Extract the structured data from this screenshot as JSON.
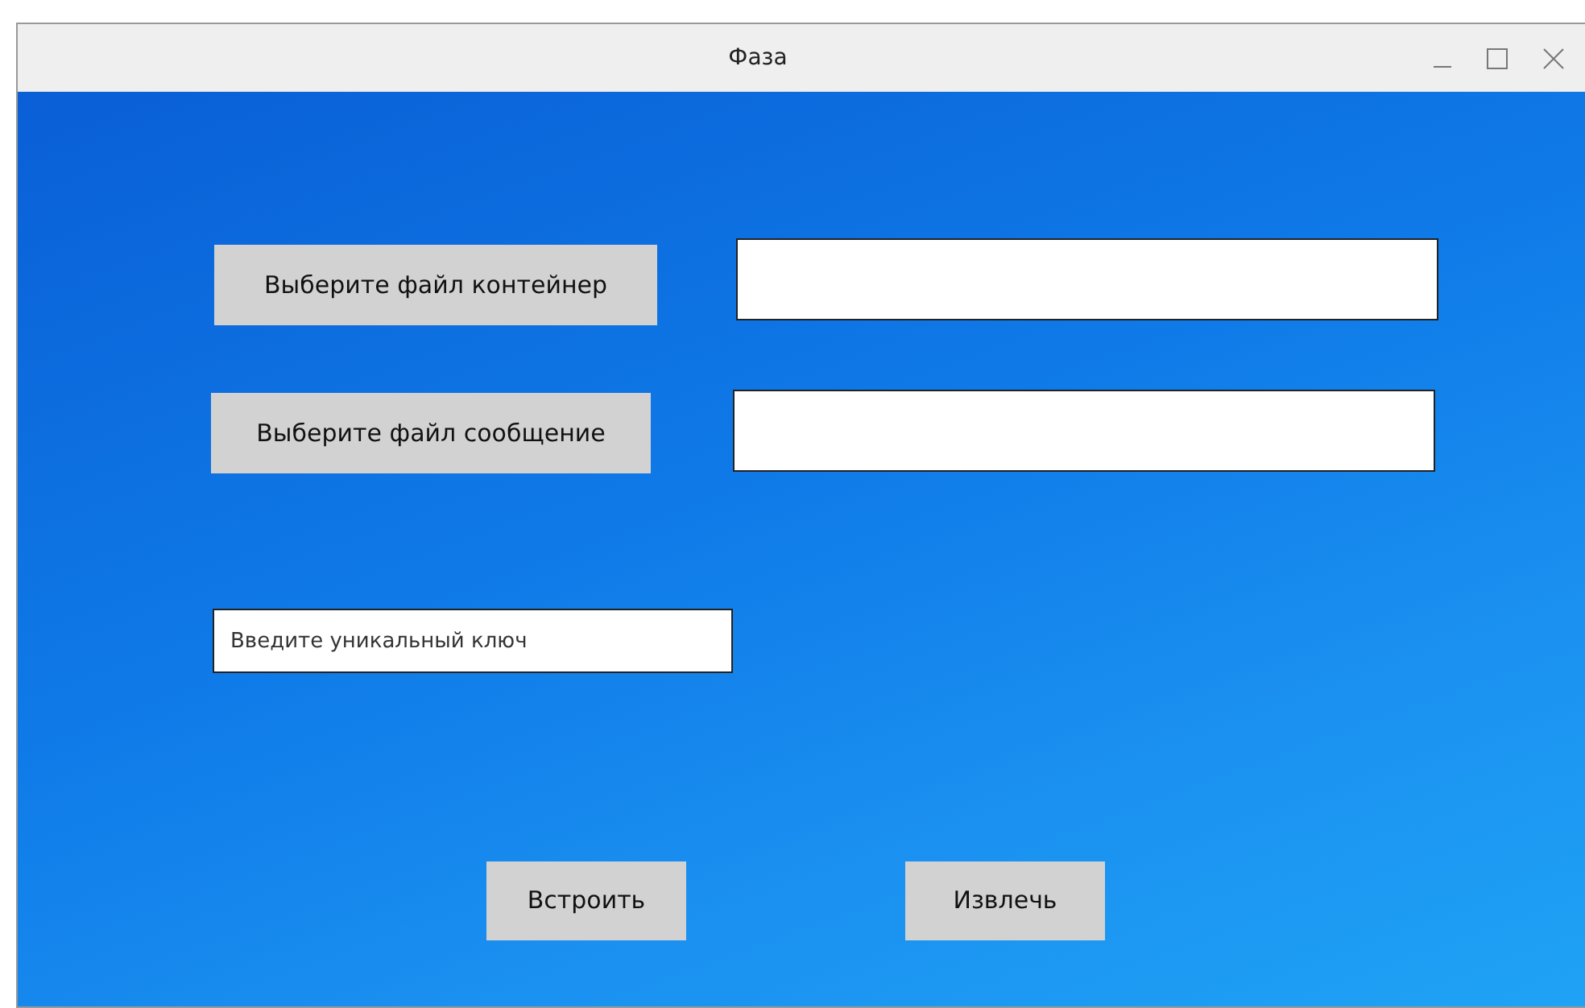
{
  "window": {
    "title": "Фаза"
  },
  "file_rows": [
    {
      "button": "Выберите  файл контейнер",
      "value": ""
    },
    {
      "button": "Выберите файл сообщение",
      "value": ""
    }
  ],
  "key_field": {
    "value": "Введите уникальный ключ"
  },
  "actions": [
    "Встроить",
    "Извлечь"
  ]
}
